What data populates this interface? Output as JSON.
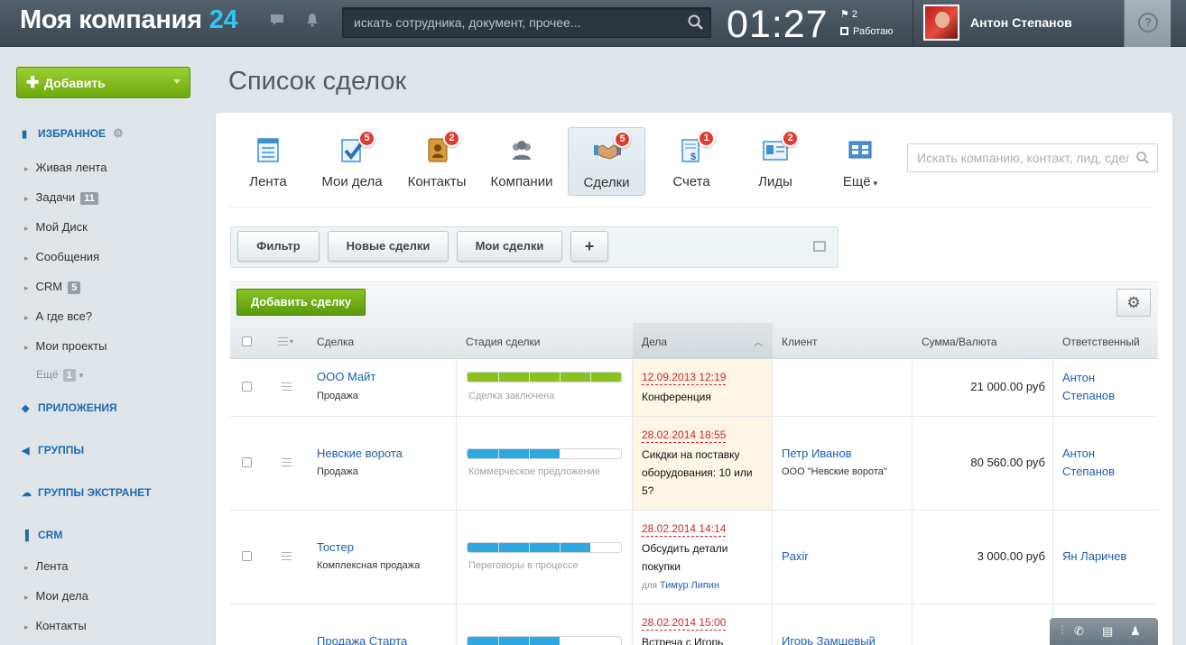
{
  "header": {
    "logo_text": "Моя компания",
    "logo_number": "24",
    "search_placeholder": "искать сотрудника, документ, прочее...",
    "clock": "01:27",
    "flag_count": "2",
    "work_status": "Работаю",
    "user_name": "Антон Степанов",
    "help": "?"
  },
  "sidebar": {
    "add_button": "Добавить",
    "favorites_title": "ИЗБРАННОЕ",
    "favorites": [
      {
        "label": "Живая лента",
        "badge": ""
      },
      {
        "label": "Задачи",
        "badge": "11"
      },
      {
        "label": "Мой Диск",
        "badge": ""
      },
      {
        "label": "Сообщения",
        "badge": ""
      },
      {
        "label": "CRM",
        "badge": "5"
      },
      {
        "label": "А где все?",
        "badge": ""
      },
      {
        "label": "Мои проекты",
        "badge": ""
      }
    ],
    "more_label": "Ещё",
    "more_badge": "1",
    "apps": "ПРИЛОЖЕНИЯ",
    "groups": "ГРУППЫ",
    "extranet": "ГРУППЫ ЭКСТРАНЕТ",
    "crm_title": "CRM",
    "crm_items": [
      "Лента",
      "Мои дела",
      "Контакты"
    ]
  },
  "page_title": "Список сделок",
  "crm_tabs": [
    {
      "label": "Лента",
      "count": ""
    },
    {
      "label": "Мои дела",
      "count": "5"
    },
    {
      "label": "Контакты",
      "count": "2"
    },
    {
      "label": "Компании",
      "count": ""
    },
    {
      "label": "Сделки",
      "count": "5"
    },
    {
      "label": "Счета",
      "count": "1"
    },
    {
      "label": "Лиды",
      "count": "2"
    },
    {
      "label": "Ещё",
      "count": ""
    }
  ],
  "crm_search_placeholder": "Искать компанию, контакт, лид, сделку",
  "filters": {
    "filter": "Фильтр",
    "new_deals": "Новые сделки",
    "my_deals": "Мои сделки",
    "add": "+"
  },
  "add_deal_button": "Добавить сделку",
  "columns": {
    "deal": "Сделка",
    "stage": "Стадия сделки",
    "tasks": "Дела",
    "client": "Клиент",
    "sum": "Сумма/Валюта",
    "responsible": "Ответственный"
  },
  "colors": {
    "green_stage": "#8cc21f",
    "blue_stage": "#2fa7e0",
    "accent_link": "#1d5faf"
  },
  "rows": [
    {
      "name": "ООО Майт",
      "type": "Продажа",
      "stage": "Сделка заключена",
      "progress": 1.0,
      "stage_color": "green",
      "date": "12.09.2013 12:19",
      "task": "Конференция",
      "client": "",
      "client_company": "",
      "sum": "21 000.00 руб",
      "responsible_1": "Антон",
      "responsible_2": "Степанов"
    },
    {
      "name": "Невские ворота",
      "type": "Продажа",
      "stage": "Коммерческое предложение",
      "progress": 0.6,
      "stage_color": "blue",
      "date": "28.02.2014 18:55",
      "task": "Сикдки на поставку оборудования: 10 или 5?",
      "client": "Петр Иванов",
      "client_company": "ООО \"Невские ворота\"",
      "sum": "80 560.00 руб",
      "responsible_1": "Антон",
      "responsible_2": "Степанов"
    },
    {
      "name": "Тостер",
      "type": "Комплексная продажа",
      "stage": "Переговоры в процессе",
      "progress": 0.8,
      "stage_color": "blue",
      "date": "28.02.2014 14:14",
      "task": "Обсудить детали покупки",
      "task_for": "для",
      "task_person": "Тимур Липин",
      "client": "Paxir",
      "client_company": "",
      "sum": "3 000.00 руб",
      "responsible_1": "Ян Ларичев",
      "responsible_2": ""
    },
    {
      "name": "Продажа Старта",
      "type": "",
      "stage": "",
      "progress": 0.6,
      "stage_color": "blue",
      "date": "28.02.2014 15:00",
      "task": "Встреча с Игорь",
      "client": "Игорь Замшевый",
      "client_company": "",
      "sum": "",
      "responsible_1": "",
      "responsible_2": ""
    }
  ]
}
